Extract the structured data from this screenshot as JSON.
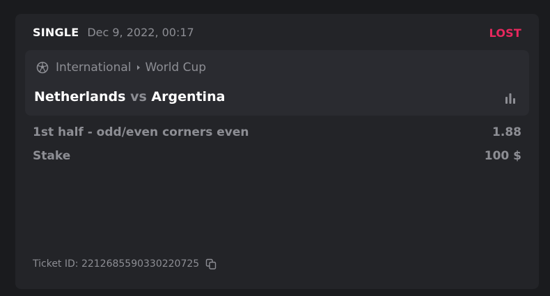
{
  "ticket": {
    "type": "SINGLE",
    "date": "Dec 9, 2022, 00:17",
    "status": "LOST",
    "status_color": "#e8285e"
  },
  "event": {
    "sport_icon": "soccer-ball-icon",
    "category": "International",
    "tournament": "World Cup",
    "home_team": "Netherlands",
    "vs_label": "vs",
    "away_team": "Argentina",
    "stats_icon": "bar-chart-icon"
  },
  "bet": {
    "market": "1st half - odd/even corners even",
    "odds": "1.88",
    "stake_label": "Stake",
    "stake_value": "100 $"
  },
  "footer": {
    "ticket_id_label": "Ticket ID: 2212685590330220725",
    "copy_icon": "copy-icon"
  },
  "colors": {
    "background": "#1a1b1e",
    "card": "#232428",
    "event_box": "#2a2b30",
    "text_primary": "#ffffff",
    "text_muted": "#8d8e94"
  }
}
